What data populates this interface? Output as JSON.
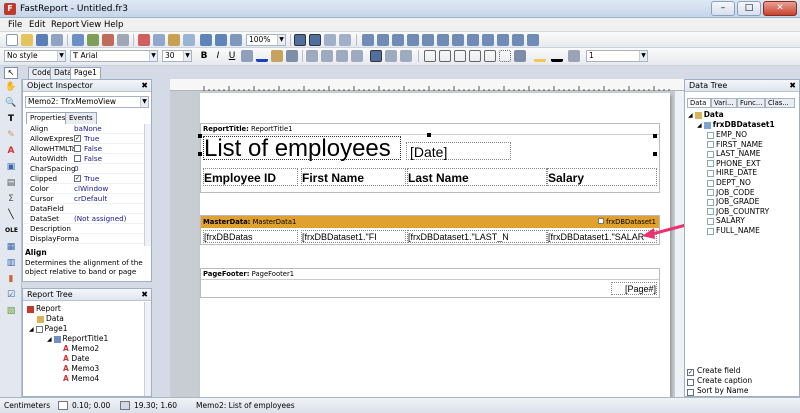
{
  "window": {
    "title": "FastReport - Untitled.fr3",
    "minimize": "–",
    "maximize": "□",
    "close": "✕"
  },
  "menu": [
    "File",
    "Edit",
    "Report",
    "View",
    "Help"
  ],
  "toolbar": {
    "zoom": "100%",
    "style": "No style",
    "font": "Arial",
    "size": "30",
    "frame_width": "1",
    "bold": "B",
    "italic": "I",
    "underline": "U"
  },
  "tabs": [
    "Code",
    "Data",
    "Page1"
  ],
  "object_inspector": {
    "title": "Object Inspector",
    "selected": "Memo2: TfrxMemoView",
    "tabs": [
      "Properties",
      "Events"
    ],
    "properties": [
      {
        "name": "Align",
        "value": "baNone"
      },
      {
        "name": "AllowExpress",
        "value": "True",
        "check": true
      },
      {
        "name": "AllowHTMLTa",
        "value": "False",
        "check": false
      },
      {
        "name": "AutoWidth",
        "value": "False",
        "check": false
      },
      {
        "name": "CharSpacing",
        "value": "0"
      },
      {
        "name": "Clipped",
        "value": "True",
        "check": true
      },
      {
        "name": "Color",
        "value": "clWindow"
      },
      {
        "name": "Cursor",
        "value": "crDefault"
      },
      {
        "name": "DataField",
        "value": ""
      },
      {
        "name": "DataSet",
        "value": "(Not assigned)"
      },
      {
        "name": "Description",
        "value": ""
      },
      {
        "name": "DisplayForma",
        "value": ""
      }
    ],
    "help_title": "Align",
    "help_text": "Determines the alignment of the object relative to band or page"
  },
  "report_tree": {
    "title": "Report Tree",
    "items": [
      "Report",
      "Data",
      "Page1",
      "ReportTitle1",
      "Memo2",
      "Date",
      "Memo3",
      "Memo4"
    ]
  },
  "design": {
    "report_title_band": "ReportTitle:",
    "report_title_name": "ReportTitle1",
    "title_text": "List of employees",
    "date_text": "[Date]",
    "headers": [
      "Employee ID",
      "First Name",
      "Last Name",
      "Salary"
    ],
    "master_band": "MasterData:",
    "master_name": "MasterData1",
    "master_dataset": "frxDBDataset1",
    "fields": [
      "[frxDBDatas",
      "[frxDBDataset1.\"FI",
      "[frxDBDataset1.\"LAST_N",
      "[frxDBDataset1.\"SALAR"
    ],
    "footer_band": "PageFooter:",
    "footer_name": "PageFooter1",
    "page_num": "[Page#]"
  },
  "data_tree": {
    "title": "Data Tree",
    "tabs": [
      "Data",
      "Vari...",
      "Func...",
      "Clas..."
    ],
    "root": "Data",
    "dataset": "frxDBDataset1",
    "fields": [
      "EMP_NO",
      "FIRST_NAME",
      "LAST_NAME",
      "PHONE_EXT",
      "HIRE_DATE",
      "DEPT_NO",
      "JOB_CODE",
      "JOB_GRADE",
      "JOB_COUNTRY",
      "SALARY",
      "FULL_NAME"
    ],
    "options": [
      {
        "label": "Create field",
        "checked": true
      },
      {
        "label": "Create caption",
        "checked": false
      },
      {
        "label": "Sort by Name",
        "checked": false
      }
    ]
  },
  "status": {
    "units": "Centimeters",
    "pos": "0.10; 0.00",
    "size": "19.30; 1.60",
    "info": "Memo2: List of employees"
  },
  "colors": {
    "master_band": "#e0a12e",
    "arrow": "#e8336f"
  }
}
